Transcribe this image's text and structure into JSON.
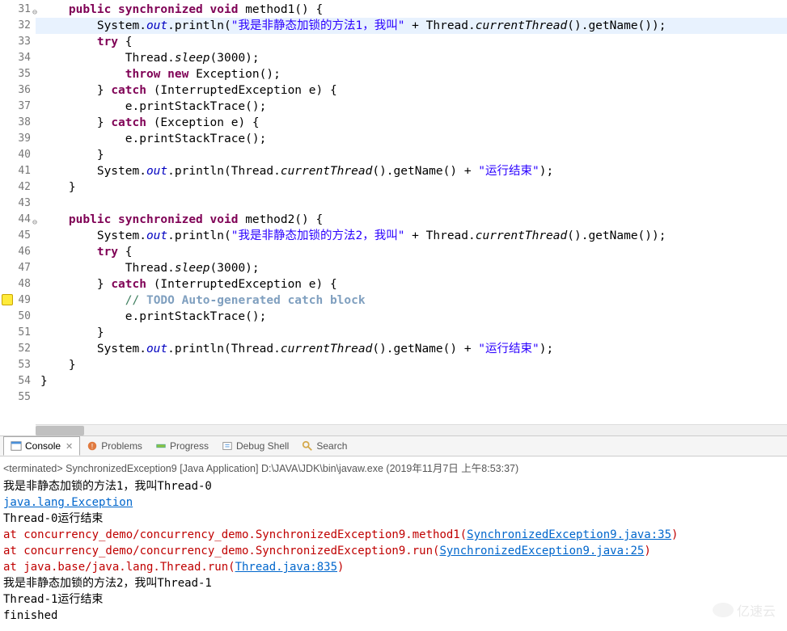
{
  "code": {
    "lines": [
      {
        "n": 31,
        "fold": true,
        "indent": "    ",
        "tokens": [
          {
            "t": "public ",
            "c": "kw"
          },
          {
            "t": "synchronized ",
            "c": "kw"
          },
          {
            "t": "void ",
            "c": "kw"
          },
          {
            "t": "method1() {"
          }
        ]
      },
      {
        "n": 32,
        "hl": true,
        "indent": "        ",
        "tokens": [
          {
            "t": "System."
          },
          {
            "t": "out",
            "c": "static-field"
          },
          {
            "t": ".println("
          },
          {
            "t": "\"我是非静态加锁的方法1，我叫\"",
            "c": "str"
          },
          {
            "t": " + Thread."
          },
          {
            "t": "currentThread",
            "c": "static-method"
          },
          {
            "t": "().getName());"
          }
        ]
      },
      {
        "n": 33,
        "indent": "        ",
        "tokens": [
          {
            "t": "try ",
            "c": "kw"
          },
          {
            "t": "{"
          }
        ]
      },
      {
        "n": 34,
        "indent": "            ",
        "tokens": [
          {
            "t": "Thread."
          },
          {
            "t": "sleep",
            "c": "static-method"
          },
          {
            "t": "(3000);"
          }
        ]
      },
      {
        "n": 35,
        "indent": "            ",
        "tokens": [
          {
            "t": "throw ",
            "c": "kw"
          },
          {
            "t": "new ",
            "c": "kw"
          },
          {
            "t": "Exception();"
          }
        ]
      },
      {
        "n": 36,
        "indent": "        ",
        "tokens": [
          {
            "t": "} "
          },
          {
            "t": "catch ",
            "c": "kw"
          },
          {
            "t": "(InterruptedException e) {"
          }
        ]
      },
      {
        "n": 37,
        "indent": "            ",
        "tokens": [
          {
            "t": "e.printStackTrace();"
          }
        ]
      },
      {
        "n": 38,
        "indent": "        ",
        "tokens": [
          {
            "t": "} "
          },
          {
            "t": "catch ",
            "c": "kw"
          },
          {
            "t": "(Exception e) {"
          }
        ]
      },
      {
        "n": 39,
        "indent": "            ",
        "tokens": [
          {
            "t": "e.printStackTrace();"
          }
        ]
      },
      {
        "n": 40,
        "indent": "        ",
        "tokens": [
          {
            "t": "}"
          }
        ]
      },
      {
        "n": 41,
        "indent": "        ",
        "tokens": [
          {
            "t": "System."
          },
          {
            "t": "out",
            "c": "static-field"
          },
          {
            "t": ".println(Thread."
          },
          {
            "t": "currentThread",
            "c": "static-method"
          },
          {
            "t": "().getName() + "
          },
          {
            "t": "\"运行结束\"",
            "c": "str"
          },
          {
            "t": ");"
          }
        ]
      },
      {
        "n": 42,
        "indent": "    ",
        "tokens": [
          {
            "t": "}"
          }
        ]
      },
      {
        "n": 43,
        "indent": "",
        "tokens": []
      },
      {
        "n": 44,
        "fold": true,
        "indent": "    ",
        "tokens": [
          {
            "t": "public ",
            "c": "kw"
          },
          {
            "t": "synchronized ",
            "c": "kw"
          },
          {
            "t": "void ",
            "c": "kw"
          },
          {
            "t": "method2() {"
          }
        ]
      },
      {
        "n": 45,
        "indent": "        ",
        "tokens": [
          {
            "t": "System."
          },
          {
            "t": "out",
            "c": "static-field"
          },
          {
            "t": ".println("
          },
          {
            "t": "\"我是非静态加锁的方法2，我叫\"",
            "c": "str"
          },
          {
            "t": " + Thread."
          },
          {
            "t": "currentThread",
            "c": "static-method"
          },
          {
            "t": "().getName());"
          }
        ]
      },
      {
        "n": 46,
        "indent": "        ",
        "tokens": [
          {
            "t": "try ",
            "c": "kw"
          },
          {
            "t": "{"
          }
        ]
      },
      {
        "n": 47,
        "indent": "            ",
        "tokens": [
          {
            "t": "Thread."
          },
          {
            "t": "sleep",
            "c": "static-method"
          },
          {
            "t": "(3000);"
          }
        ]
      },
      {
        "n": 48,
        "indent": "        ",
        "tokens": [
          {
            "t": "} "
          },
          {
            "t": "catch ",
            "c": "kw"
          },
          {
            "t": "(InterruptedException e) {"
          }
        ]
      },
      {
        "n": 49,
        "quickfix": true,
        "indent": "            ",
        "tokens": [
          {
            "t": "// ",
            "c": "comment"
          },
          {
            "t": "TODO",
            "c": "comment-todo"
          },
          {
            "t": " Auto-generated catch block",
            "c": "comment-todo"
          }
        ]
      },
      {
        "n": 50,
        "indent": "            ",
        "tokens": [
          {
            "t": "e.printStackTrace();"
          }
        ]
      },
      {
        "n": 51,
        "indent": "        ",
        "tokens": [
          {
            "t": "}"
          }
        ]
      },
      {
        "n": 52,
        "indent": "        ",
        "tokens": [
          {
            "t": "System."
          },
          {
            "t": "out",
            "c": "static-field"
          },
          {
            "t": ".println(Thread."
          },
          {
            "t": "currentThread",
            "c": "static-method"
          },
          {
            "t": "().getName() + "
          },
          {
            "t": "\"运行结束\"",
            "c": "str"
          },
          {
            "t": ");"
          }
        ]
      },
      {
        "n": 53,
        "indent": "    ",
        "tokens": [
          {
            "t": "}"
          }
        ]
      },
      {
        "n": 54,
        "indent": "",
        "tokens": [
          {
            "t": "}"
          }
        ]
      },
      {
        "n": 55,
        "indent": "",
        "tokens": []
      }
    ]
  },
  "views": {
    "tabs": [
      {
        "label": "Console",
        "active": true,
        "icon": "console"
      },
      {
        "label": "Problems",
        "icon": "problems"
      },
      {
        "label": "Progress",
        "icon": "progress"
      },
      {
        "label": "Debug Shell",
        "icon": "debug"
      },
      {
        "label": "Search",
        "icon": "search"
      }
    ]
  },
  "console": {
    "terminated": "<terminated> SynchronizedException9 [Java Application] D:\\JAVA\\JDK\\bin\\javaw.exe (2019年11月7日 上午8:53:37)",
    "lines": [
      {
        "type": "out",
        "text": "我是非静态加锁的方法1，我叫Thread-0"
      },
      {
        "type": "err-link",
        "text": "java.lang.Exception"
      },
      {
        "type": "out",
        "text": "Thread-0运行结束"
      },
      {
        "type": "err",
        "indent": "        ",
        "parts": [
          {
            "t": "at concurrency_demo/concurrency_demo.SynchronizedException9.method1("
          },
          {
            "t": "SynchronizedException9.java:35",
            "link": true
          },
          {
            "t": ")"
          }
        ]
      },
      {
        "type": "err",
        "indent": "        ",
        "parts": [
          {
            "t": "at concurrency_demo/concurrency_demo.SynchronizedException9.run("
          },
          {
            "t": "SynchronizedException9.java:25",
            "link": true
          },
          {
            "t": ")"
          }
        ]
      },
      {
        "type": "err",
        "indent": "        ",
        "parts": [
          {
            "t": "at java.base/java.lang.Thread.run("
          },
          {
            "t": "Thread.java:835",
            "link": true
          },
          {
            "t": ")"
          }
        ]
      },
      {
        "type": "out",
        "text": "我是非静态加锁的方法2，我叫Thread-1"
      },
      {
        "type": "out",
        "text": "Thread-1运行结束"
      },
      {
        "type": "out",
        "text": "finished"
      }
    ]
  },
  "watermark": "亿速云"
}
